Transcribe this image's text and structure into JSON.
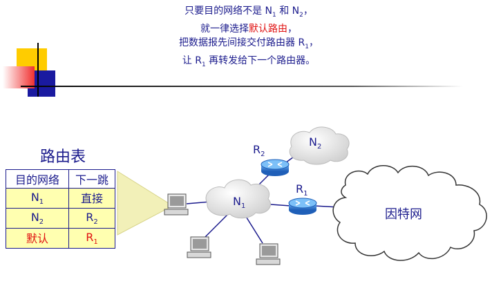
{
  "caption": {
    "line1_a": "只要目的网络不是 N",
    "line1_sub1": "1",
    "line1_b": " 和 N",
    "line1_sub2": "2",
    "line1_c": "，",
    "line2_a": "就一律选择",
    "line2_red": "默认路由",
    "line2_b": "，",
    "line3_a": "把数据报先间接交付路由器 R",
    "line3_sub": "1",
    "line3_b": "，",
    "line4_a": "让 R",
    "line4_sub": "1",
    "line4_b": " 再转发给下一个路由器。"
  },
  "routing_table": {
    "title": "路由表",
    "headers": [
      "目的网络",
      "下一跳"
    ],
    "rows": [
      {
        "dest_main": "N",
        "dest_sub": "1",
        "next_main": "直接",
        "next_sub": ""
      },
      {
        "dest_main": "N",
        "dest_sub": "2",
        "next_main": "R",
        "next_sub": "2"
      },
      {
        "dest_main": "默认",
        "dest_sub": "",
        "next_main": "R",
        "next_sub": "1"
      }
    ]
  },
  "network": {
    "n1_main": "N",
    "n1_sub": "1",
    "n2_main": "N",
    "n2_sub": "2",
    "r1_main": "R",
    "r1_sub": "1",
    "r2_main": "R",
    "r2_sub": "2",
    "internet": "因特网"
  },
  "colors": {
    "text": "#1a1a8c",
    "accent_red": "#e01010",
    "table_fill": "#ffffb0",
    "router": "#2a7bd6"
  },
  "icons": [
    "router-icon",
    "computer-icon",
    "cloud-icon"
  ]
}
